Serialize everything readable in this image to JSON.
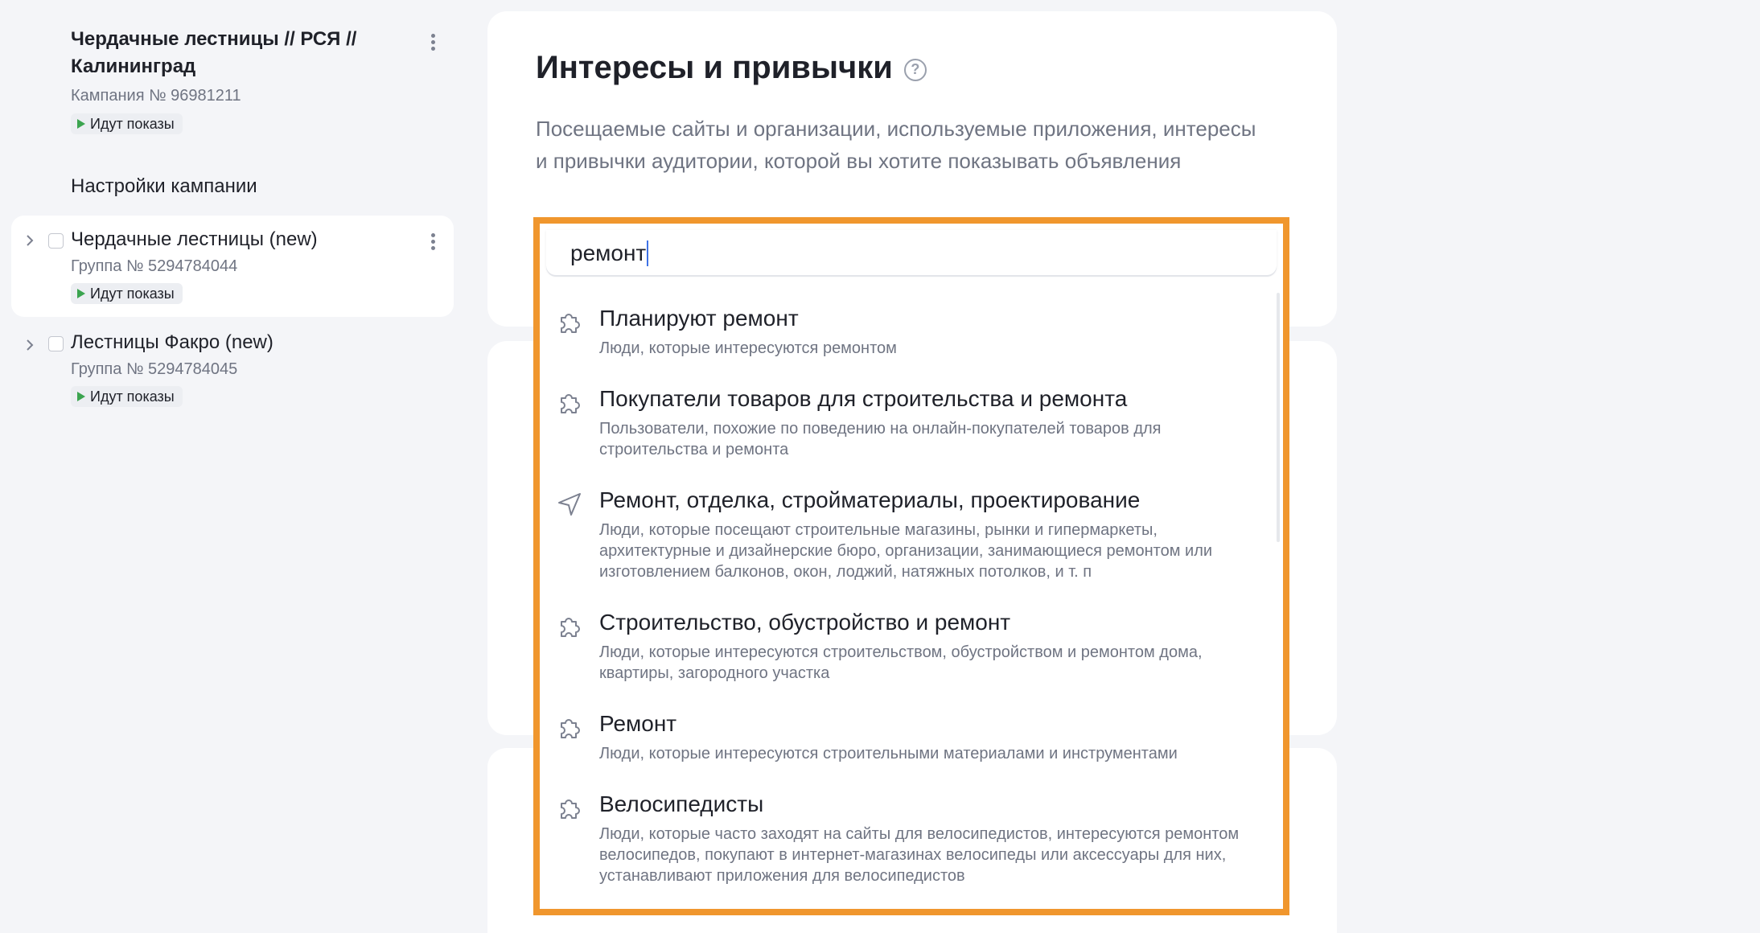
{
  "campaign": {
    "title": "Чердачные лестницы // РСЯ // Калининград",
    "number": "Кампания № 96981211",
    "status": "Идут показы"
  },
  "sidebar": {
    "settings_label": "Настройки кампании",
    "groups": [
      {
        "name": "Чердачные лестницы (new)",
        "number": "Группа № 5294784044",
        "status": "Идут показы"
      },
      {
        "name": "Лестницы Факро (new)",
        "number": "Группа № 5294784045",
        "status": "Идут показы"
      }
    ]
  },
  "section": {
    "title": "Интересы и привычки",
    "description": "Посещаемые сайты и организации, используемые приложения, интересы и привычки аудитории, которой вы хотите показывать объявления"
  },
  "search": {
    "value": "ремонт"
  },
  "options": [
    {
      "icon": "puzzle-icon",
      "title": "Планируют ремонт",
      "description": "Люди, которые интересуются ремонтом"
    },
    {
      "icon": "puzzle-icon",
      "title": "Покупатели товаров для строительства и ремонта",
      "description": "Пользователи, похожие по поведению на онлайн-покупателей товаров для строительства и ремонта"
    },
    {
      "icon": "location-arrow-icon",
      "title": "Ремонт, отделка, стройматериалы, проектирование",
      "description": "Люди, которые посещают строительные магазины, рынки и гипермаркеты, архитектурные и дизайнерские бюро, организации, занимающиеся ремонтом или изготовлением балконов, окон, лоджий, натяжных потолков, и т. п"
    },
    {
      "icon": "puzzle-icon",
      "title": "Строительство, обустройство и ремонт",
      "description": "Люди, которые интересуются строительством, обустройством и ремонтом дома, квартиры, загородного участка"
    },
    {
      "icon": "puzzle-icon",
      "title": "Ремонт",
      "description": "Люди, которые интересуются строительными материалами и инструментами"
    },
    {
      "icon": "puzzle-icon",
      "title": "Велосипедисты",
      "description": "Люди, которые часто заходят на сайты для велосипедистов, интересуются ремонтом велосипедов, покупают в интернет-магазинах велосипеды или аксессуары для них, устанавливают приложения для велосипедистов"
    }
  ],
  "colors": {
    "highlight": "#f0962d",
    "status_play": "#3ba44f",
    "caret": "#3f72e6"
  }
}
